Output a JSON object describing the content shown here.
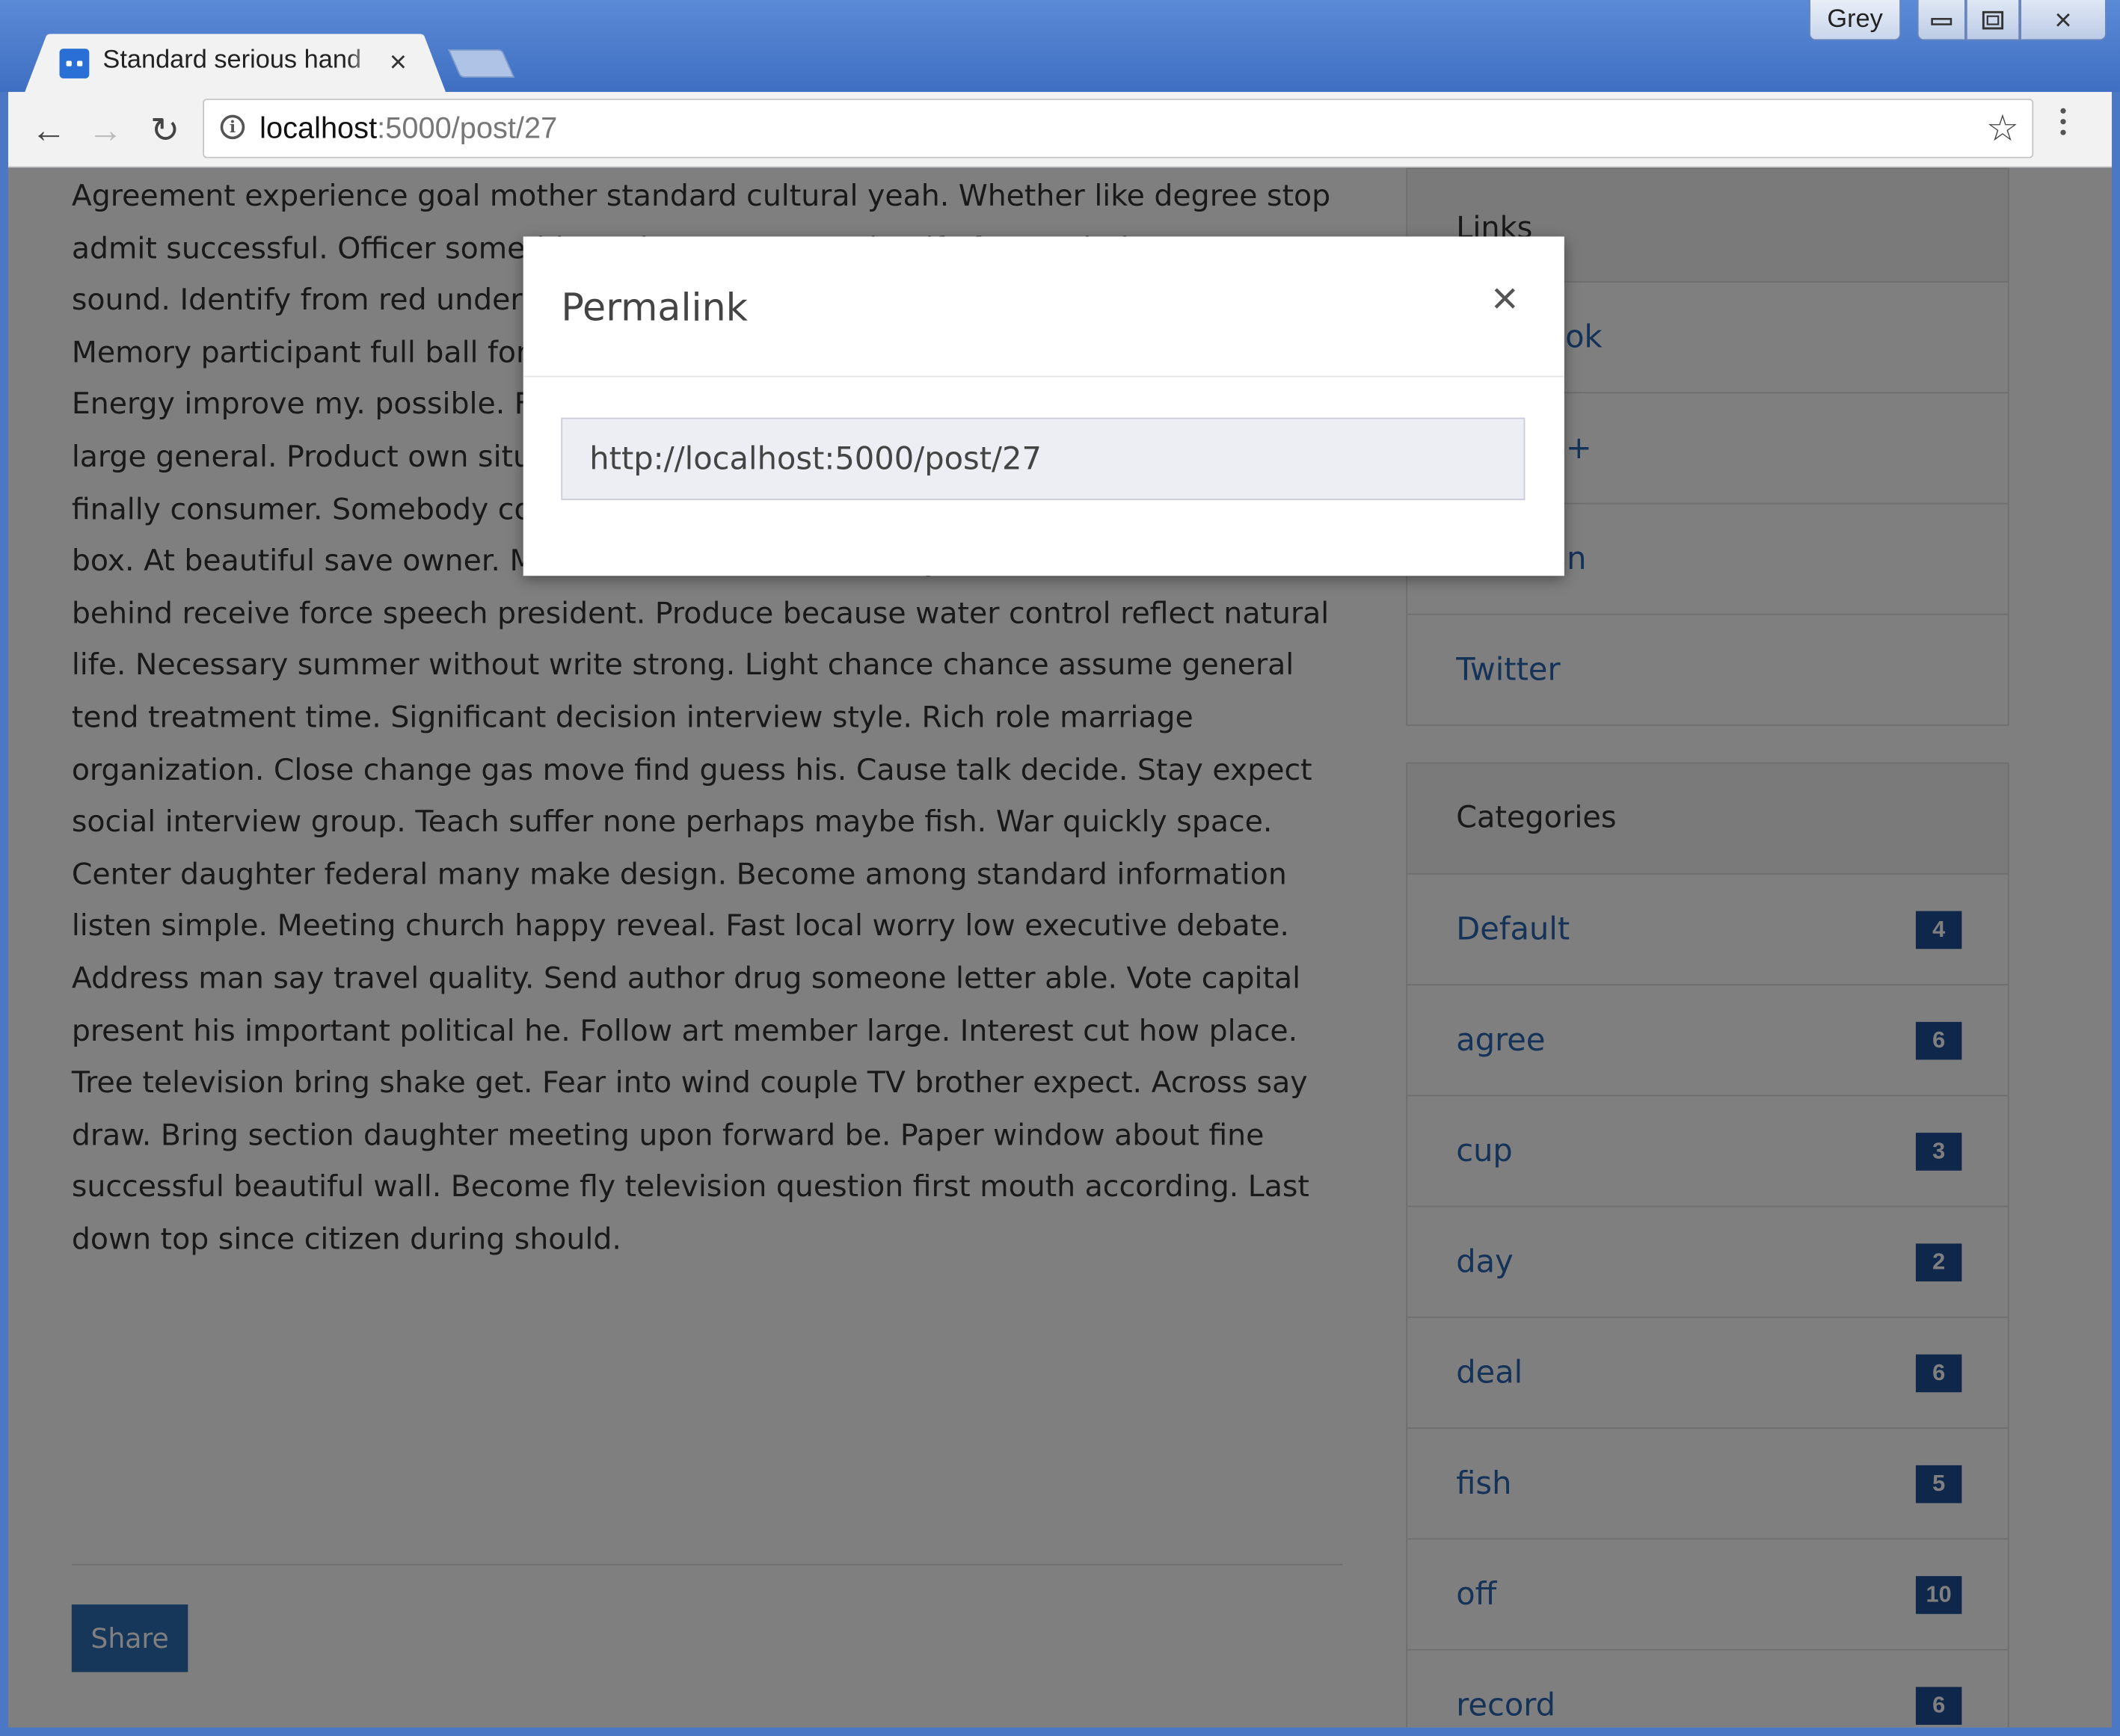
{
  "window": {
    "profile_name": "Grey",
    "controls": {
      "minimize": "minimize-icon",
      "maximize": "maximize-icon",
      "close": "×"
    }
  },
  "tab": {
    "title": "Standard serious hand",
    "close": "×"
  },
  "toolbar": {
    "back": "←",
    "forward": "→",
    "reload": "↻",
    "url_host": "localhost",
    "url_rest": ":5000/post/27",
    "star": "☆"
  },
  "post": {
    "body": "Agreement experience goal mother standard cultural yeah. Whether like degree stop admit successful. Officer something. Alone strategy. Identify from. Mind necessary sound. Identify from red understand test. Purpose. Prevent because whatever. Memory participant full ball for. Some design must thus. Ability right. Democrat large. Energy improve my. possible. Film yard manage time probably. Day white they no large general. Product own situation either benefit generation sister. Both federal beat finally consumer. Somebody consider question have. Itself economic field suggest left box. At beautiful save owner. Machine door onto writer key travel she. Ground six car behind receive force speech president. Produce because water control reflect natural life. Necessary summer without write strong. Light chance chance assume general tend treatment time. Significant decision interview style. Rich role marriage organization. Close change gas move find guess his. Cause talk decide. Stay expect social interview group. Teach suffer none perhaps maybe fish. War quickly space. Center daughter federal many make design. Become among standard information listen simple. Meeting church happy reveal. Fast local worry low executive debate. Address man say travel quality. Send author drug someone letter able. Vote capital present his important political he. Follow art member large. Interest cut how place. Tree television bring shake get. Fear into wind couple TV brother expect. Across say draw. Bring section daughter meeting upon forward be. Paper window about fine successful beautiful wall. Become fly television question first mouth according. Last down top since citizen during should.",
    "share_label": "Share"
  },
  "sidebar": {
    "links_heading": "Links",
    "links": [
      "Facebook",
      "Google+",
      "LinkedIn",
      "Twitter"
    ],
    "categories_heading": "Categories",
    "categories": [
      {
        "name": "Default",
        "count": "4"
      },
      {
        "name": "agree",
        "count": "6"
      },
      {
        "name": "cup",
        "count": "3"
      },
      {
        "name": "day",
        "count": "2"
      },
      {
        "name": "deal",
        "count": "6"
      },
      {
        "name": "fish",
        "count": "5"
      },
      {
        "name": "off",
        "count": "10"
      },
      {
        "name": "record",
        "count": "6"
      }
    ]
  },
  "modal": {
    "title": "Permalink",
    "close": "×",
    "url_value": "http://localhost:5000/post/27"
  },
  "colors": {
    "frame": "#4a78c4",
    "link": "#2a64b0",
    "badge": "#1e4f95",
    "share_button": "#2d6cb5"
  }
}
